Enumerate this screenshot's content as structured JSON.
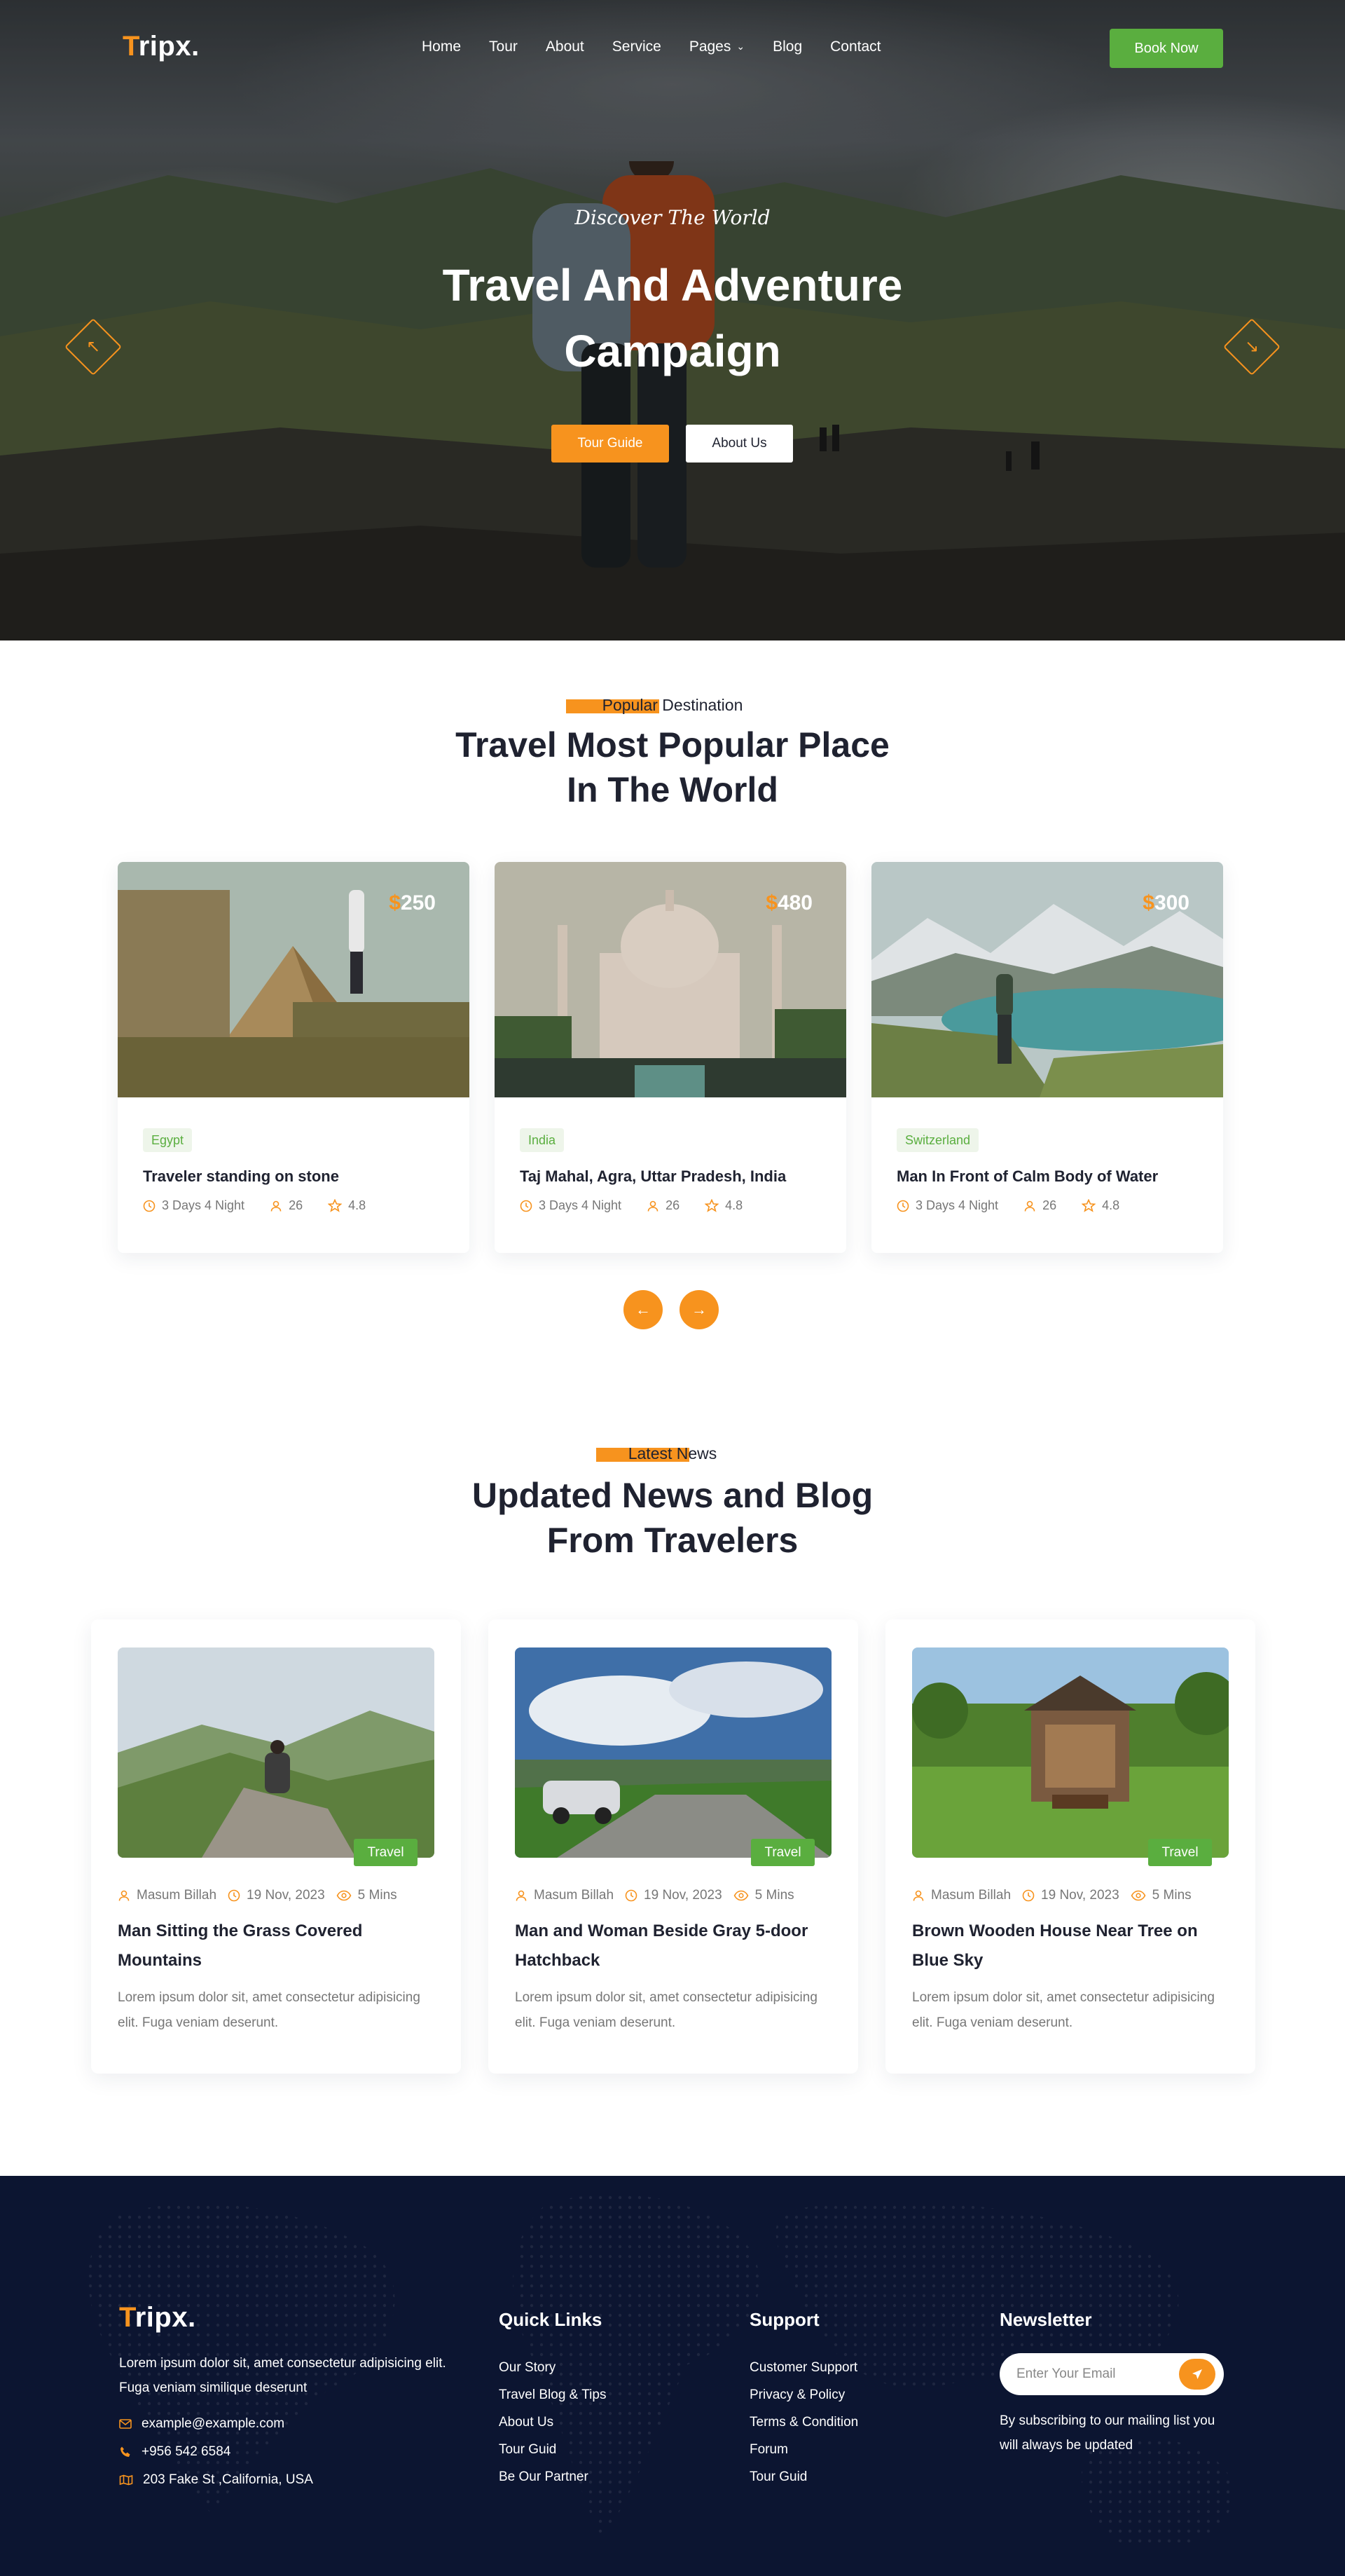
{
  "brand": {
    "first_letter": "T",
    "rest": "ripx."
  },
  "colors": {
    "accent": "#f7931e",
    "green": "#5aae3f",
    "footer_bg": "#0c1531",
    "text": "#1f2230"
  },
  "nav": {
    "items": [
      "Home",
      "Tour",
      "About",
      "Service",
      "Pages",
      "Blog",
      "Contact"
    ],
    "pages_has_dropdown": true,
    "book_label": "Book Now"
  },
  "hero": {
    "kicker": "Discover The World",
    "title_line1": "Travel And Adventure",
    "title_line2": "Campaign",
    "btn_primary": "Tour Guide",
    "btn_secondary": "About Us"
  },
  "destinations": {
    "kicker_highlight": "Popular",
    "kicker_rest": " Destination",
    "title_line1": "Travel Most Popular Place",
    "title_line2": "In The World",
    "cards": [
      {
        "currency": "$",
        "price": "250",
        "tag": "Egypt",
        "title": "Traveler standing on stone",
        "duration": "3 Days 4 Night",
        "people": "26",
        "rating": "4.8"
      },
      {
        "currency": "$",
        "price": "480",
        "tag": "India",
        "title": "Taj Mahal, Agra, Uttar Pradesh, India",
        "duration": "3 Days 4 Night",
        "people": "26",
        "rating": "4.8"
      },
      {
        "currency": "$",
        "price": "300",
        "tag": "Switzerland",
        "title": "Man In Front of Calm Body of Water",
        "duration": "3 Days 4 Night",
        "people": "26",
        "rating": "4.8"
      }
    ],
    "prev_arrow": "←",
    "next_arrow": "→"
  },
  "blog": {
    "kicker_highlight": "Latest N",
    "kicker_rest": "ews",
    "title_line1": "Updated News and Blog",
    "title_line2": "From Travelers",
    "posts": [
      {
        "tag": "Travel",
        "author": "Masum Billah",
        "date": "19 Nov, 2023",
        "read": "5 Mins",
        "title": "Man Sitting the Grass Covered Mountains",
        "text": "Lorem ipsum dolor sit, amet consectetur adipisicing elit. Fuga veniam deserunt."
      },
      {
        "tag": "Travel",
        "author": "Masum Billah",
        "date": "19 Nov, 2023",
        "read": "5 Mins",
        "title": "Man and Woman Beside Gray 5-door Hatchback",
        "text": "Lorem ipsum dolor sit, amet consectetur adipisicing elit. Fuga veniam deserunt."
      },
      {
        "tag": "Travel",
        "author": "Masum Billah",
        "date": "19 Nov, 2023",
        "read": "5 Mins",
        "title": "Brown Wooden House Near Tree on Blue Sky",
        "text": "Lorem ipsum dolor sit, amet consectetur adipisicing elit. Fuga veniam deserunt."
      }
    ]
  },
  "footer": {
    "description": "Lorem ipsum dolor sit, amet consectetur adipisicing elit. Fuga veniam similique deserunt",
    "email": "example@example.com",
    "phone": "+956 542 6584",
    "address": "203 Fake St ,California, USA",
    "quick_links_title": "Quick Links",
    "quick_links": [
      "Our Story",
      "Travel Blog & Tips",
      "About Us",
      "Tour Guid",
      "Be Our Partner"
    ],
    "support_title": "Support",
    "support_links": [
      "Customer Support",
      "Privacy & Policy",
      "Terms & Condition",
      "Forum",
      "Tour Guid"
    ],
    "newsletter_title": "Newsletter",
    "newsletter_placeholder": "Enter Your Email",
    "newsletter_note": "By subscribing to our mailing list you will always be updated"
  }
}
